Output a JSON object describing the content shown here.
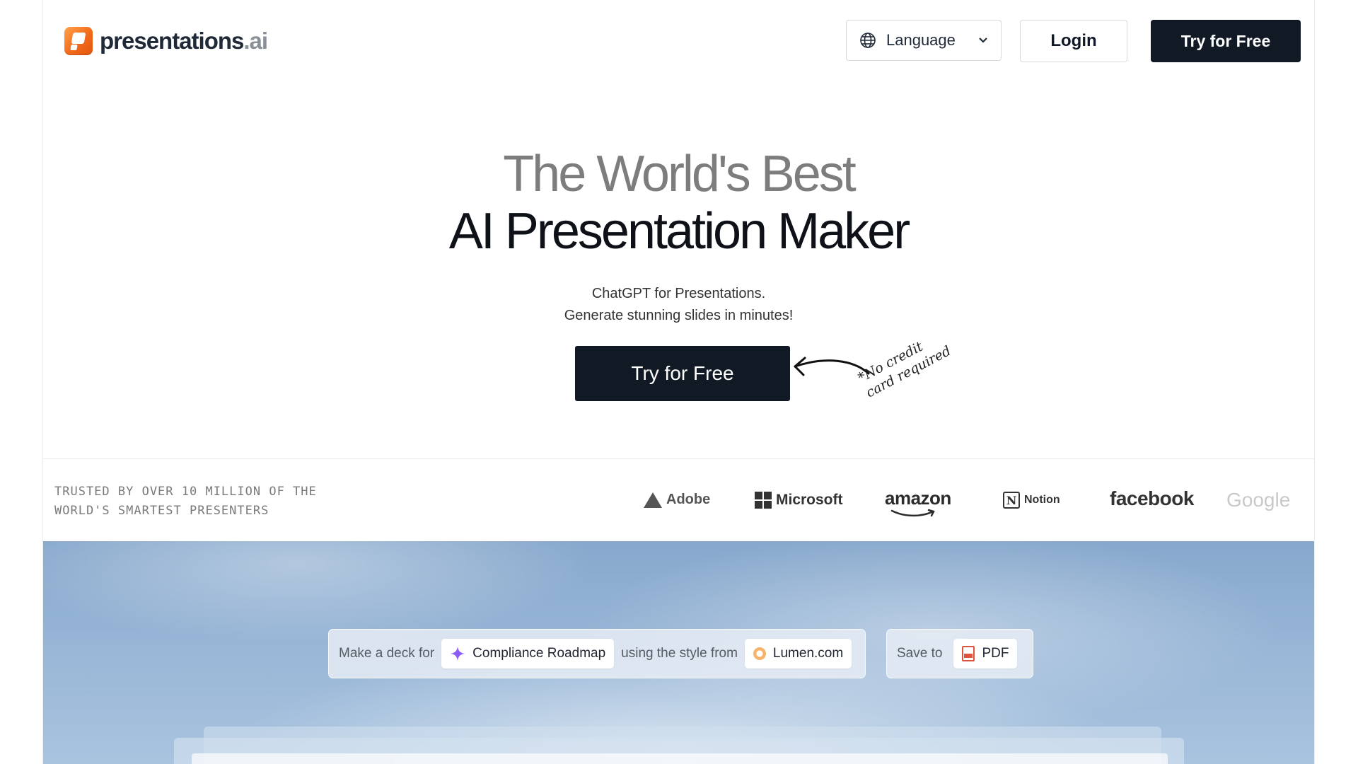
{
  "header": {
    "logo_text": "presentations",
    "logo_suffix": ".ai",
    "language_label": "Language",
    "login_label": "Login",
    "try_label": "Try for Free"
  },
  "hero": {
    "line1": "The World's Best",
    "line2": "AI Presentation Maker",
    "subtitle1": "ChatGPT for Presentations.",
    "subtitle2": "Generate stunning slides in minutes!",
    "cta_label": "Try for Free",
    "note_line1": "*No credit",
    "note_line2": "card required"
  },
  "trusted": {
    "text_line1": "TRUSTED BY OVER 10 MILLION OF THE",
    "text_line2": "WORLD'S SMARTEST PRESENTERS",
    "brands": [
      "Adobe",
      "Microsoft",
      "amazon",
      "Notion",
      "facebook",
      "Google"
    ]
  },
  "prompt": {
    "prefix": "Make a deck for",
    "topic": "Compliance Roadmap",
    "middle": "using the style from",
    "style_source": "Lumen.com",
    "save_prefix": "Save to",
    "save_format": "PDF"
  },
  "colors": {
    "primary_dark": "#111a24",
    "logo_orange": "#f26a1b",
    "sky_blue": "#97b5d6",
    "sparkle_purple": "#8b5cf6"
  }
}
